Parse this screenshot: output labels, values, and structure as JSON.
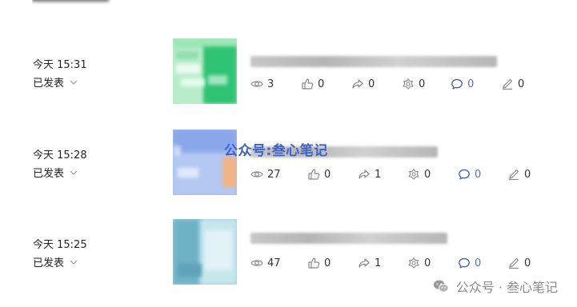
{
  "watermark": {
    "text": "公众号:叁心笔记"
  },
  "footer": {
    "text": "公众号 · 叁心笔记",
    "icon": "wechat-icon"
  },
  "articles": [
    {
      "time": "今天 15:31",
      "status": "已发表",
      "stats": {
        "views": "3",
        "likes": "0",
        "shares": "0",
        "favorites": "0",
        "comments": "0",
        "edits": "0"
      }
    },
    {
      "time": "今天 15:28",
      "status": "已发表",
      "stats": {
        "views": "27",
        "likes": "0",
        "shares": "1",
        "favorites": "0",
        "comments": "0",
        "edits": "0"
      }
    },
    {
      "time": "今天 15:25",
      "status": "已发表",
      "stats": {
        "views": "47",
        "likes": "0",
        "shares": "1",
        "favorites": "0",
        "comments": "0",
        "edits": "0"
      }
    }
  ],
  "colors": {
    "accent": "#5470c6",
    "watermark": "#3f62c8"
  }
}
